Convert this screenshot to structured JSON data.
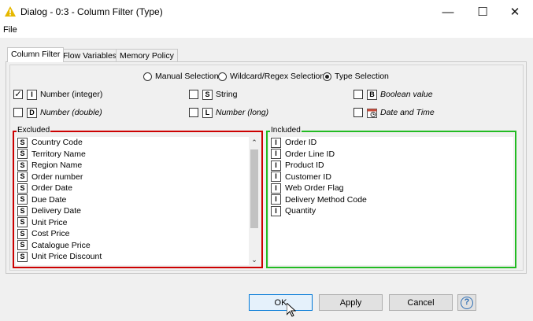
{
  "window": {
    "title": "Dialog - 0:3 - Column Filter (Type)",
    "icon": "warning-triangle-icon",
    "controls": {
      "minimize": "—",
      "maximize": "☐",
      "close": "✕"
    }
  },
  "menu": {
    "file": "File"
  },
  "tabs": [
    {
      "label": "Column Filter",
      "active": true
    },
    {
      "label": "Flow Variables",
      "active": false
    },
    {
      "label": "Memory Policy",
      "active": false
    }
  ],
  "selection_modes": {
    "manual": "Manual Selection",
    "wildcard": "Wildcard/Regex Selection",
    "type": "Type Selection",
    "selected": "type"
  },
  "type_options": {
    "integer": {
      "badge": "I",
      "label": "Number (integer)",
      "checked": true,
      "check_mark": "✓"
    },
    "string": {
      "badge": "S",
      "label": "String",
      "checked": false
    },
    "boolean": {
      "badge": "B",
      "label": "Boolean value",
      "checked": false
    },
    "double": {
      "badge": "D",
      "label": "Number (double)",
      "checked": false
    },
    "long": {
      "badge": "L",
      "label": "Number (long)",
      "checked": false
    },
    "datetime": {
      "badge": "date-time-icon",
      "label": "Date and Time",
      "checked": false
    }
  },
  "excluded": {
    "title": "Excluded",
    "items": [
      {
        "badge": "S",
        "label": "Country Code"
      },
      {
        "badge": "S",
        "label": "Territory Name"
      },
      {
        "badge": "S",
        "label": "Region Name"
      },
      {
        "badge": "S",
        "label": "Order number"
      },
      {
        "badge": "S",
        "label": "Order Date"
      },
      {
        "badge": "S",
        "label": "Due Date"
      },
      {
        "badge": "S",
        "label": "Delivery Date"
      },
      {
        "badge": "S",
        "label": "Unit Price"
      },
      {
        "badge": "S",
        "label": "Cost Price"
      },
      {
        "badge": "S",
        "label": "Catalogue Price"
      },
      {
        "badge": "S",
        "label": "Unit Price Discount"
      }
    ],
    "scroll_up": "⌃",
    "scroll_down": "⌄"
  },
  "included": {
    "title": "Included",
    "items": [
      {
        "badge": "I",
        "label": "Order ID"
      },
      {
        "badge": "I",
        "label": "Order Line ID"
      },
      {
        "badge": "I",
        "label": "Product ID"
      },
      {
        "badge": "I",
        "label": "Customer ID"
      },
      {
        "badge": "I",
        "label": "Web Order Flag"
      },
      {
        "badge": "I",
        "label": "Delivery Method Code"
      },
      {
        "badge": "I",
        "label": "Quantity"
      }
    ]
  },
  "buttons": {
    "ok": "OK",
    "apply": "Apply",
    "cancel": "Cancel",
    "help": "?"
  },
  "colors": {
    "excluded_border": "#cc0000",
    "included_border": "#22bb22",
    "title_icon": "#e6b800"
  }
}
